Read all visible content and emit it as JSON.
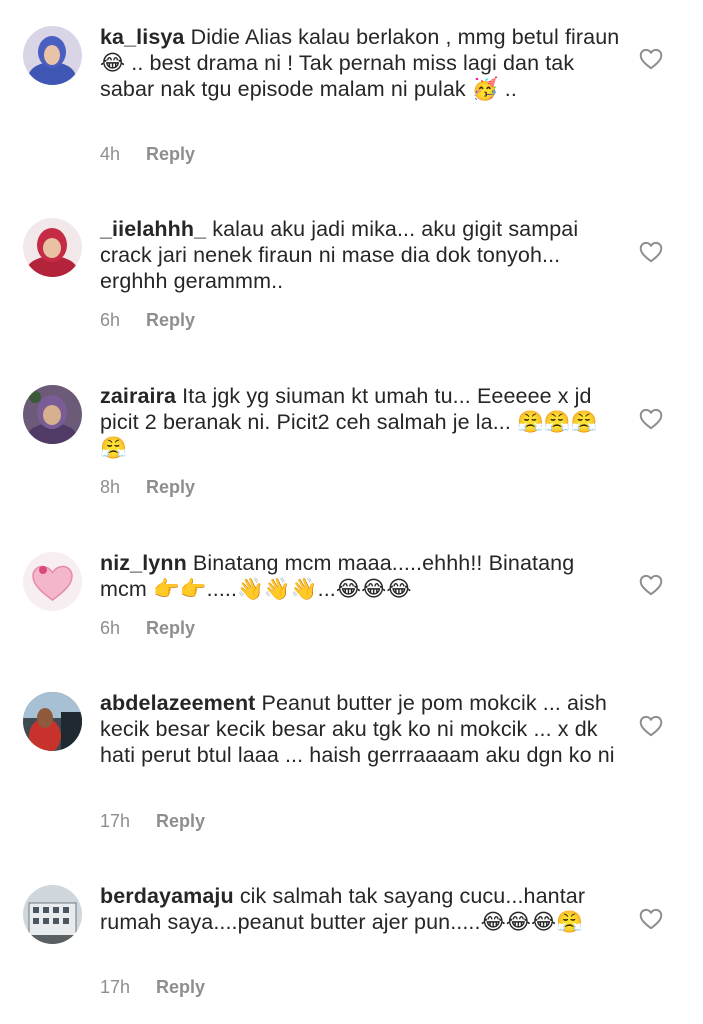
{
  "comments": [
    {
      "username": "ka_lisya",
      "text": " Didie Alias kalau berlakon , mmg betul firaun 😂 .. best drama ni ! Tak pernah miss lagi dan tak sabar nak tgu episode malam ni pulak 🥳 ..",
      "time": "4h",
      "reply_label": "Reply",
      "avatar": "woman-in-blue-hijab-avatar"
    },
    {
      "username": "_iielahhh_",
      "text": " kalau aku jadi mika... aku gigit sampai crack jari nenek firaun ni mase dia dok tonyoh... erghhh gerammm..",
      "time": "6h",
      "reply_label": "Reply",
      "avatar": "woman-in-red-hijab-avatar"
    },
    {
      "username": "zairaira",
      "text": " Ita jgk yg siuman kt umah tu... Eeeeee x jd picit 2 beranak ni. Picit2 ceh salmah je la... 😤😤😤😤",
      "time": "8h",
      "reply_label": "Reply",
      "avatar": "woman-in-purple-hijab-avatar"
    },
    {
      "username": "niz_lynn",
      "text": " Binatang mcm maaa.....ehhh!! Binatang mcm 👉👉.....👋👋👋...😂😂😂",
      "time": "6h",
      "reply_label": "Reply",
      "avatar": "pink-heart-avatar"
    },
    {
      "username": "abdelazeement",
      "text": " Peanut butter je pom mokcik ... aish kecik besar kecik besar aku tgk ko ni mokcik ... x dk hati perut btul laaa ... haish gerrraaaam aku dgn ko ni",
      "time": "17h",
      "reply_label": "Reply",
      "avatar": "person-in-car-avatar"
    },
    {
      "username": "berdayamaju",
      "text": " cik salmah tak sayang cucu...hantar rumah saya....peanut butter ajer pun.....😂😂😂😤",
      "time": "17h",
      "reply_label": "Reply",
      "avatar": "building-avatar"
    }
  ],
  "colors": {
    "text": "#262626",
    "meta": "#8e8e8e",
    "heart": "#8e8e8e"
  },
  "icons": {
    "like": "heart-outline-icon"
  }
}
